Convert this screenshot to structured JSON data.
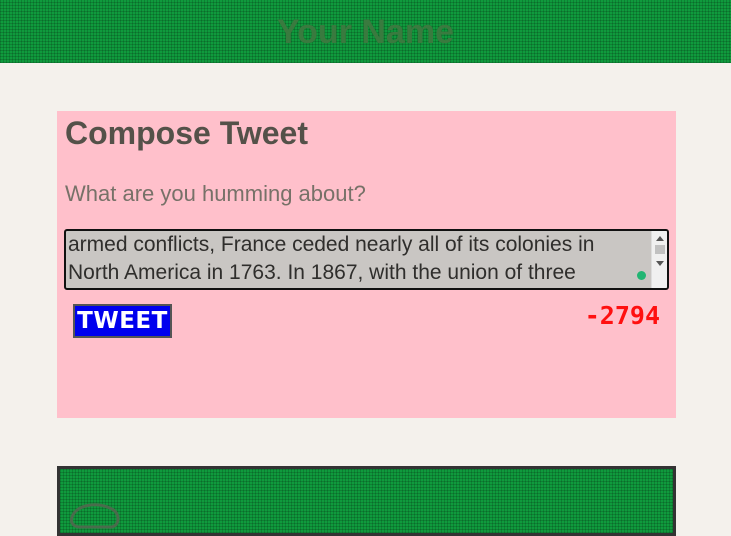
{
  "header": {
    "title": "Your Name"
  },
  "compose": {
    "heading": "Compose Tweet",
    "prompt": "What are you humming about?",
    "textarea_value": "armed conflicts, France ceded nearly all of its colonies in\nNorth America in 1763. In 1867, with the union of three",
    "button_label": "TWEET",
    "counter": "-2794"
  },
  "feed": {
    "avatar_icon": "avatar-icon"
  }
}
